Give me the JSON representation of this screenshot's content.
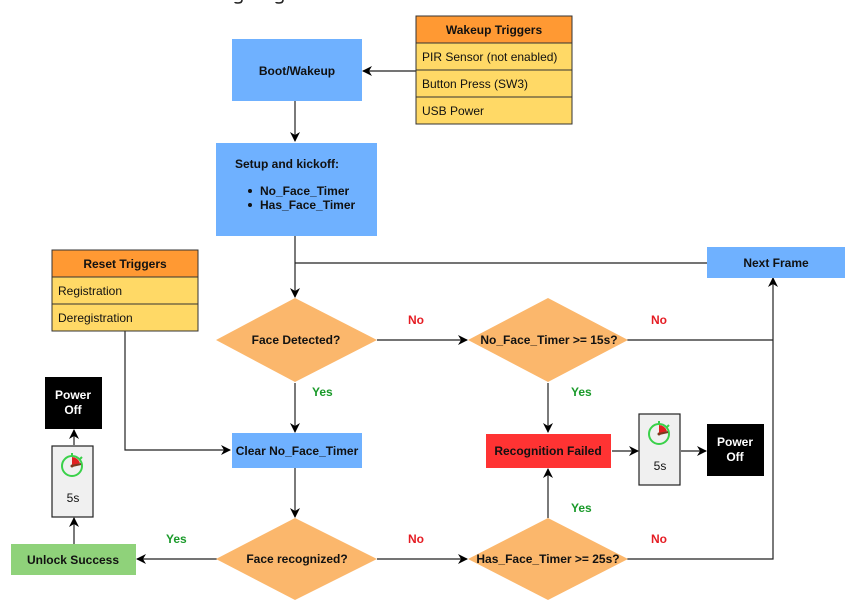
{
  "title_cropped": "gg",
  "colors": {
    "process_blue": "#6fb1ff",
    "decision_orange": "#fbb76c",
    "header_orange": "#ff9933",
    "row_yellow": "#ffd966",
    "fail_red": "#ff3333",
    "success_green": "#8fd27a",
    "power_black": "#000000",
    "yes_green": "#1a9a2a",
    "no_red": "#e51c23"
  },
  "wakeup_triggers": {
    "header": "Wakeup Triggers",
    "items": [
      "PIR Sensor (not enabled)",
      "Button Press (SW3)",
      "USB Power"
    ]
  },
  "reset_triggers": {
    "header": "Reset Triggers",
    "items": [
      "Registration",
      "Deregistration"
    ]
  },
  "nodes": {
    "boot": "Boot/Wakeup",
    "setup_title": "Setup and kickoff:",
    "setup_items": [
      "No_Face_Timer",
      "Has_Face_Timer"
    ],
    "next_frame": "Next Frame",
    "face_detected": "Face Detected?",
    "no_face_timer_check": "No_Face_Timer >= 15s?",
    "clear_timer": "Clear No_Face_Timer",
    "recognition_failed": "Recognition Failed",
    "face_recognized": "Face recognized?",
    "has_face_timer_check": "Has_Face_Timer >= 25s?",
    "unlock_success": "Unlock Success",
    "power_off_line1": "Power",
    "power_off_line2": "Off",
    "timer_label": "5s"
  },
  "edge_labels": {
    "yes": "Yes",
    "no": "No"
  }
}
